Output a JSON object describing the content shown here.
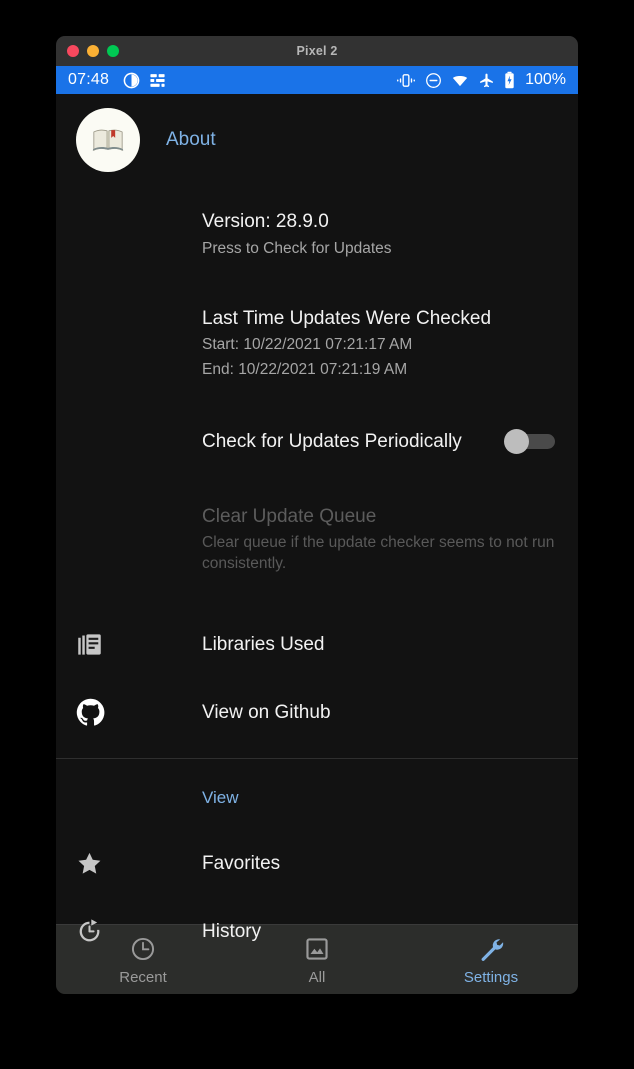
{
  "window": {
    "title": "Pixel 2",
    "traffic_lights": [
      {
        "name": "close",
        "color": "#f8485e"
      },
      {
        "name": "minimize",
        "color": "#fbb034"
      },
      {
        "name": "zoom",
        "color": "#00c853"
      }
    ]
  },
  "status_bar": {
    "clock": "07:48",
    "background": "#1a73e8",
    "left_icons": [
      "contrast-icon",
      "sliders-icon"
    ],
    "right_icons": [
      "vibrate-icon",
      "do-not-disturb-icon",
      "wifi-icon",
      "airplane-mode-icon",
      "battery-icon"
    ],
    "battery_text": "100%"
  },
  "about": {
    "avatar_icon": "open-book-icon",
    "title": "About",
    "title_color": "#7fb2e5",
    "version": {
      "primary": "Version: 28.9.0",
      "secondary": "Press to Check for Updates"
    },
    "last_check": {
      "primary": "Last Time Updates Were Checked",
      "start": "Start: 10/22/2021 07:21:17 AM",
      "end": "End: 10/22/2021 07:21:19 AM"
    },
    "periodic": {
      "label": "Check for Updates Periodically",
      "toggle_state": "off",
      "knob_color": "#bdbdbd",
      "track_color": "#4a4a4a"
    },
    "clear_queue": {
      "primary": "Clear Update Queue",
      "secondary": "Clear queue if the update checker seems to not run consistently.",
      "disabled": true
    },
    "links": [
      {
        "icon": "library-books-icon",
        "label": "Libraries Used"
      },
      {
        "icon": "github-icon",
        "label": "View on Github"
      }
    ]
  },
  "view_section": {
    "header": "View",
    "header_color": "#7fb2e5",
    "items": [
      {
        "icon": "star-icon",
        "label": "Favorites"
      },
      {
        "icon": "history-icon",
        "label": "History"
      }
    ]
  },
  "bottom_nav": {
    "active_color": "#7fb2e5",
    "inactive_color": "#9a9a9a",
    "items": [
      {
        "icon": "clock-icon",
        "label": "Recent",
        "active": false
      },
      {
        "icon": "image-icon",
        "label": "All",
        "active": false
      },
      {
        "icon": "wrench-icon",
        "label": "Settings",
        "active": true
      }
    ]
  }
}
